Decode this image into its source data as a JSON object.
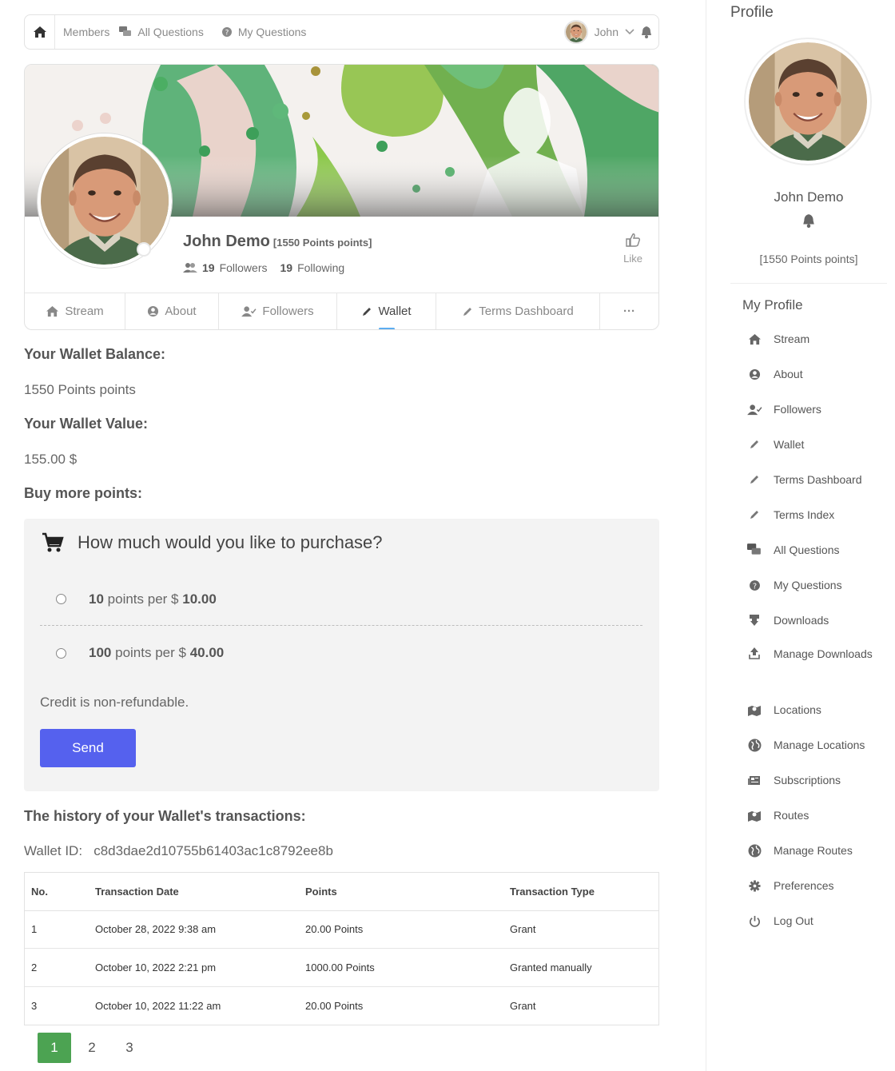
{
  "topnav": {
    "items": [
      "Members",
      "All Questions",
      "My Questions"
    ],
    "user_name": "John"
  },
  "profile": {
    "name": "John Demo",
    "points_label": "[1550 Points points]",
    "followers_count": "19",
    "followers_label": "Followers",
    "following_count": "19",
    "following_label": "Following",
    "like_label": "Like"
  },
  "tabs": [
    {
      "label": "Stream",
      "icon": "home-icon"
    },
    {
      "label": "About",
      "icon": "user-circle-icon"
    },
    {
      "label": "Followers",
      "icon": "user-check-icon"
    },
    {
      "label": "Wallet",
      "icon": "pencil-icon",
      "active": true
    },
    {
      "label": "Terms Dashboard",
      "icon": "pencil-icon"
    },
    {
      "label": "···",
      "icon": "more-icon"
    }
  ],
  "wallet": {
    "balance_heading": "Your Wallet Balance:",
    "balance_value": "1550 Points points",
    "value_heading": "Your Wallet Value:",
    "value_amount": "155.00 $",
    "buy_heading": "Buy more points:",
    "purchase_question": "How much would you like to purchase?",
    "options": [
      {
        "points": "10",
        "mid": "points per $",
        "price": "10.00"
      },
      {
        "points": "100",
        "mid": "points per $",
        "price": "40.00"
      }
    ],
    "refund_note": "Credit is non-refundable.",
    "send_label": "Send",
    "history_heading": "The history of your Wallet's transactions:",
    "wallet_id_label": "Wallet ID:",
    "wallet_id": "c8d3dae2d10755b61403ac1c8792ee8b"
  },
  "transactions": {
    "headers": [
      "No.",
      "Transaction Date",
      "Points",
      "Transaction Type"
    ],
    "rows": [
      [
        "1",
        "October 28, 2022 9:38 am",
        "20.00 Points",
        "Grant"
      ],
      [
        "2",
        "October 10, 2022 2:21 pm",
        "1000.00 Points",
        "Granted manually"
      ],
      [
        "3",
        "October 10, 2022 11:22 am",
        "20.00 Points",
        "Grant"
      ]
    ]
  },
  "pagination": {
    "pages": [
      "1",
      "2",
      "3"
    ],
    "current": "1"
  },
  "sidebar": {
    "title": "Profile",
    "name": "John Demo",
    "points": "[1550 Points points]",
    "menu_heading": "My Profile",
    "items": [
      {
        "label": "Stream",
        "icon": "home-icon"
      },
      {
        "label": "About",
        "icon": "user-circle-icon"
      },
      {
        "label": "Followers",
        "icon": "user-check-icon"
      },
      {
        "label": "Wallet",
        "icon": "pencil-icon"
      },
      {
        "label": "Terms Dashboard",
        "icon": "pencil-icon"
      },
      {
        "label": "Terms Index",
        "icon": "pencil-icon"
      },
      {
        "label": "All Questions",
        "icon": "comments-icon"
      },
      {
        "label": "My Questions",
        "icon": "question-icon"
      },
      {
        "label": "Downloads",
        "icon": "download-icon"
      },
      {
        "label": "Manage Downloads",
        "icon": "upload-icon"
      },
      {
        "label": "Locations",
        "icon": "map-icon"
      },
      {
        "label": "Manage Locations",
        "icon": "globe-icon"
      },
      {
        "label": "Subscriptions",
        "icon": "newspaper-icon"
      },
      {
        "label": "Routes",
        "icon": "map-icon"
      },
      {
        "label": "Manage Routes",
        "icon": "globe-icon"
      },
      {
        "label": "Preferences",
        "icon": "gear-icon"
      },
      {
        "label": "Log Out",
        "icon": "power-icon"
      }
    ]
  },
  "colors": {
    "accent": "#5561ee",
    "pager_active": "#4ca352",
    "tab_indicator": "#5cadf0"
  }
}
